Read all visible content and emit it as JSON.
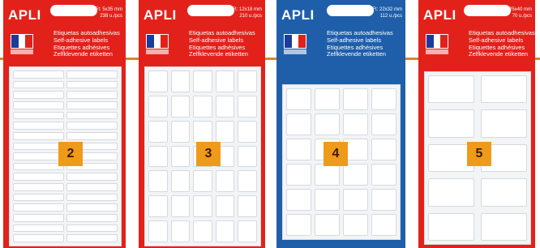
{
  "colors": {
    "red": "#e3211b",
    "blue": "#1f5faa",
    "badge": "#f09a1a",
    "divider": "#d8862e"
  },
  "packs": [
    {
      "brand": "APLI",
      "size": "Ft: 5x35 mm",
      "count": "238 u./pcs",
      "lines": [
        "Etiquetas autoadhesivas",
        "Self-adhesive labels",
        "Etiquettes adhésives",
        "Zelfklevende etiketten"
      ],
      "badge": "2"
    },
    {
      "brand": "APLI",
      "size": "Ft: 12x18 mm",
      "count": "210 u./pcs",
      "lines": [
        "Etiquetas autoadhesivas",
        "Self-adhesive labels",
        "Etiquettes adhésives",
        "Zelfklevende etiketten"
      ],
      "badge": "3"
    },
    {
      "brand": "APLI",
      "size": "Ft: 22x32 mm",
      "count": "112 u./pcs",
      "lines": [
        "Etiquetas autoadhesivas",
        "Self-adhesive labels",
        "Etiquettes adhésives",
        "Zelfklevende etiketten"
      ],
      "badge": "4"
    },
    {
      "brand": "APLI",
      "size": "Ft: 25x40 mm",
      "count": "70 u./pcs",
      "lines": [
        "Etiquetas autoadhesivas",
        "Self-adhesive labels",
        "Etiquettes adhésives",
        "Zelfklevende etiketten"
      ],
      "badge": "5"
    }
  ]
}
